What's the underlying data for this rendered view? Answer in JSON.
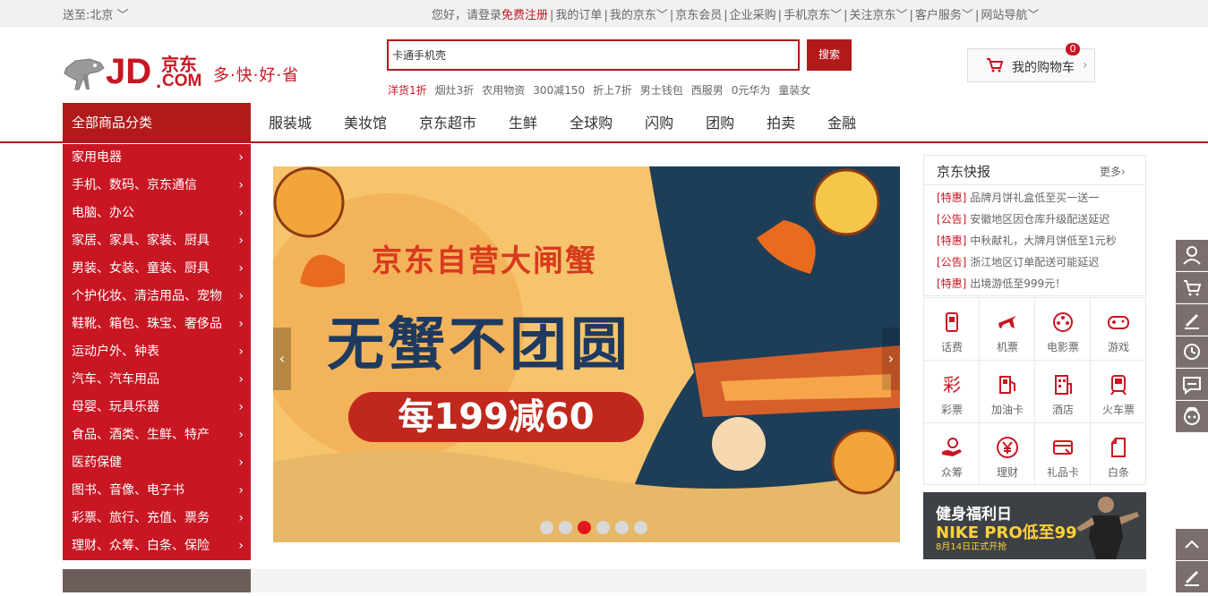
{
  "topbar": {
    "location": "送至:北京",
    "greeting": "您好，请登录",
    "register": "免费注册",
    "links": [
      "我的订单",
      "我的京东",
      "京东会员",
      "企业采购",
      "手机京东",
      "关注京东",
      "客户服务",
      "网站导航"
    ]
  },
  "logo": {
    "jd": "JD",
    "dot": ".",
    "com": "COM",
    "cn": "京东",
    "slogan": "多·快·好·省"
  },
  "search": {
    "value": "卡通手机壳",
    "button": "搜索"
  },
  "hotwords": [
    "洋货1折",
    "烟灶3折",
    "农用物资",
    "300减150",
    "折上7折",
    "男士钱包",
    "西服男",
    "0元华为",
    "童装女"
  ],
  "cart": {
    "label": "我的购物车",
    "count": "0"
  },
  "nav": {
    "all_categories": "全部商品分类",
    "items": [
      "服装城",
      "美妆馆",
      "京东超市",
      "生鲜",
      "全球购",
      "闪购",
      "团购",
      "拍卖",
      "金融"
    ]
  },
  "categories": [
    "家用电器",
    "手机、数码、京东通信",
    "电脑、办公",
    "家居、家具、家装、厨具",
    "男装、女装、童装、厨具",
    "个护化妆、清洁用品、宠物",
    "鞋靴、箱包、珠宝、奢侈品",
    "运动户外、钟表",
    "汽车、汽车用品",
    "母婴、玩具乐器",
    "食品、酒类、生鲜、特产",
    "医药保健",
    "图书、音像、电子书",
    "彩票、旅行、充值、票务",
    "理财、众筹、白条、保险"
  ],
  "banner": {
    "headline": "京东自营大闸蟹",
    "slogan": "无蟹不团圆",
    "offer": "每199减60",
    "slide_count": 6,
    "active_slide": 3,
    "prev": "‹",
    "next": "›"
  },
  "news": {
    "title": "京东快报",
    "more": "更多",
    "items": [
      {
        "tag": "[特惠]",
        "text": "品牌月饼礼盒低至买一送一"
      },
      {
        "tag": "[公告]",
        "text": "安徽地区因仓库升级配送延迟"
      },
      {
        "tag": "[特惠]",
        "text": "中秋献礼，大牌月饼低至1元秒"
      },
      {
        "tag": "[公告]",
        "text": "浙江地区订单配送可能延迟"
      },
      {
        "tag": "[特惠]",
        "text": "出境游低至999元！"
      }
    ]
  },
  "services": [
    {
      "label": "话费",
      "icon": "phone-icon"
    },
    {
      "label": "机票",
      "icon": "plane-icon"
    },
    {
      "label": "电影票",
      "icon": "film-icon"
    },
    {
      "label": "游戏",
      "icon": "gamepad-icon"
    },
    {
      "label": "彩票",
      "icon": "lottery-icon"
    },
    {
      "label": "加油卡",
      "icon": "fuel-icon"
    },
    {
      "label": "酒店",
      "icon": "hotel-icon"
    },
    {
      "label": "火车票",
      "icon": "train-icon"
    },
    {
      "label": "众筹",
      "icon": "crowdfund-icon"
    },
    {
      "label": "理财",
      "icon": "yen-icon"
    },
    {
      "label": "礼品卡",
      "icon": "giftcard-icon"
    },
    {
      "label": "白条",
      "icon": "ious-icon"
    }
  ],
  "promo": {
    "line1": "健身福利日",
    "line2": "NIKE PRO低至99",
    "line3": "8月14日正式开抢"
  },
  "colors": {
    "brand_red": "#c81623",
    "dark_red": "#b1191a",
    "gray_bg": "#f1f1f1"
  }
}
